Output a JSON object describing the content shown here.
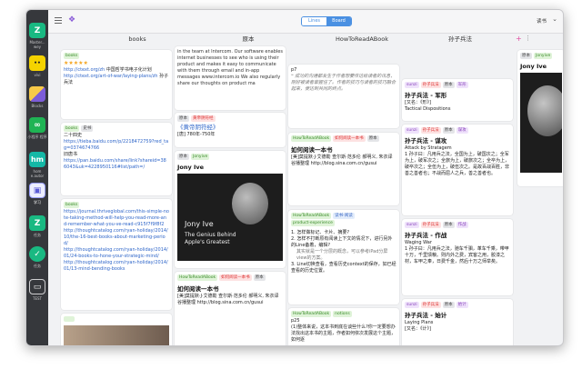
{
  "toolbar": {
    "view_lines": "Lines",
    "view_board": "Board",
    "user_menu": "读书",
    "chevron": "⌄"
  },
  "dock": {
    "items": [
      {
        "label": "Master...\nwey",
        "glyph": "Z",
        "color": "#19b982"
      },
      {
        "label": "vivi",
        "glyph": "",
        "color": "#f5d300"
      },
      {
        "label": "Blocks",
        "glyph": "",
        "color": "#7c5cd8"
      },
      {
        "label": "小程序\n程序",
        "glyph": "∞",
        "color": "#1fb454"
      },
      {
        "label": "hom\ne.autor",
        "glyph": "hm",
        "color": "#14b8a6"
      },
      {
        "label": "学习",
        "glyph": "▣",
        "color": "#eceefe"
      },
      {
        "label": "任务",
        "glyph": "Z",
        "color": "#19b982"
      },
      {
        "label": "任务",
        "glyph": "✓",
        "color": "#19b982"
      },
      {
        "label": "TEST",
        "glyph": "▭",
        "color": "#36383c"
      }
    ]
  },
  "columns": {
    "c1": "books",
    "c2": "原本",
    "c3": "HowToReadABook",
    "c4": "孙子兵法",
    "c5": ""
  },
  "col1": {
    "card1": {
      "tag": "books",
      "stars": "★★★★★",
      "link1": "http://ctext.org/zh",
      "text1": "中国哲学书电子化计划",
      "link2": "http://ctext.org/art-of-war/laying-plans/zh",
      "text2": "孙子兵法"
    },
    "card2": {
      "tag1": "books",
      "tag2": "史书",
      "text1": "二十四史",
      "link1": "https://tieba.baidu.com/p/2218472759?red_tag=0374674766",
      "text2": "旧唐书",
      "link2": "https://pan.baidu.com/share/link?shareid=386043&uk=4228950116#list/path=/"
    },
    "card3": {
      "tag": "books",
      "link1": "https://journal.thriveglobal.com/this-simple-note-taking-method-will-help-you-read-more-and-remember-what-you-ve-read-c915f7f9f8f2",
      "link2": "http://thoughtcatalog.com/ryan-holiday/2014/10/the-16-best-books-about-marketing-period/",
      "link3": "http://thoughtcatalog.com/ryan-holiday/2014/01/24-books-to-hone-your-strategic-mind/",
      "link4": "http://thoughtcatalog.com/ryan-holiday/2014/01/13-mind-bending-books"
    }
  },
  "col2": {
    "card1": {
      "text": "in the team at Intercom. Our software enables internet businesses to see who is using their product and makes it easy to communicate with them through email and in-app messages www.intercom.io We also regularly share our thoughts on product ma"
    },
    "card2": {
      "tag1": "原本",
      "tag2": "黄帝阴符经",
      "title": "《黄帝阴符经》",
      "text": "[唐] 780年-750年"
    },
    "card3": {
      "tag1": "原本",
      "tag2": "Jonyive",
      "title": "Jony Ive",
      "img_title": "Jony Ive",
      "img_sub": "The Genius Behind Apple's Greatest"
    },
    "card4": {
      "tag1": "HowToReadABook",
      "tag2": "如何阅读一本书",
      "tag3": "原本",
      "title": "如何阅读一本书",
      "text1": "[美]莫提默·J·艾德勒 查尔斯·范多伦 郝明义, 朱衣译",
      "text2": "谷播整理 http://blog.sina.com.cn/gusui"
    }
  },
  "col3": {
    "card1": {
      "text1": "p7",
      "quote": "成功的沟通都发生于作者想要传达给读者的讯息，刚好被读者掌握住了。作者的技巧与读者的技巧融合起来，便达到共同的终点。"
    },
    "card2": {
      "tag1": "HowToReadABook",
      "tag2": "如何阅读一本书",
      "tag3": "原本",
      "title": "如何阅读一本书",
      "text1": "[美]莫提默·J·艾德勒 查尔斯·范多伦 郝明义, 朱衣译",
      "text2": "谷播整理 http://blog.sina.com.cn/gusui"
    },
    "card3": {
      "tag1": "HowToReadABook",
      "tag2": "读书-阅读",
      "tag3": "product-experience",
      "item1": "怎样做标记、卡片、摘要?",
      "item2": "怎样不打断原有阅读上下文的情况下，进行另外的Line备着，编辑?",
      "note": "其实就是一个分层的概念，可以参考iPad分屏view的方案。",
      "item3": "Line切换查看，查看历史context的保存，如已经查看的历史位置。"
    },
    "card4": {
      "tag1": "HowToReadABook",
      "tag2": "notions",
      "text1": "p25",
      "text2": "(1)整体来说，这本书到底在谈些什么?你一定要想办法找出这本书的主题，作者如何依次发展这个主题，如何逐"
    }
  },
  "col4": {
    "card1": {
      "tag1": "sunzi",
      "tag2": "孙子兵法",
      "tag3": "原本",
      "tag4": "军形",
      "title": "孙子兵法 - 军形",
      "text1": "[又名：《形》]",
      "text2": "Tactical Dispositions"
    },
    "card2": {
      "tag1": "sunzi",
      "tag2": "孙子兵法",
      "tag3": "原本",
      "tag4": "谋攻",
      "title": "孙子兵法 - 谋攻",
      "text1": "Attack by Stratagem",
      "text2": "1 孙子曰：凡用兵之法，全国为上，破国次之；全军为上，破军次之；全旅为上，破旅次之；全卒为上，破卒次之；全伍为上，破伍次之。是故百战百胜，非善之善者也；不战而屈人之兵，善之善者也。"
    },
    "card3": {
      "tag1": "sunzi",
      "tag2": "孙子兵法",
      "tag3": "原本",
      "tag4": "作战",
      "title": "孙子兵法 - 作战",
      "text1": "Waging War",
      "text2": "1 孙子曰：凡用兵之法，驰车千驷，革车千乘，带甲十万，千里馈粮。则内外之费，宾客之用，胶漆之材，车甲之奉，日费千金，然后十万之师举矣。"
    },
    "card4": {
      "tag1": "sunzi",
      "tag2": "孙子兵法",
      "tag3": "原本",
      "tag4": "始计",
      "title": "孙子兵法 - 始计",
      "text1": "Laying Plans",
      "text2": "[又名：《计》]"
    }
  },
  "col5": {
    "card1": {
      "tag1": "原本",
      "tag2": "Jonyive",
      "title": "Jony Ive"
    }
  },
  "colors": {
    "accent": "#4a90e2",
    "dock_bg": "#36383c",
    "link": "#2f66c9"
  }
}
